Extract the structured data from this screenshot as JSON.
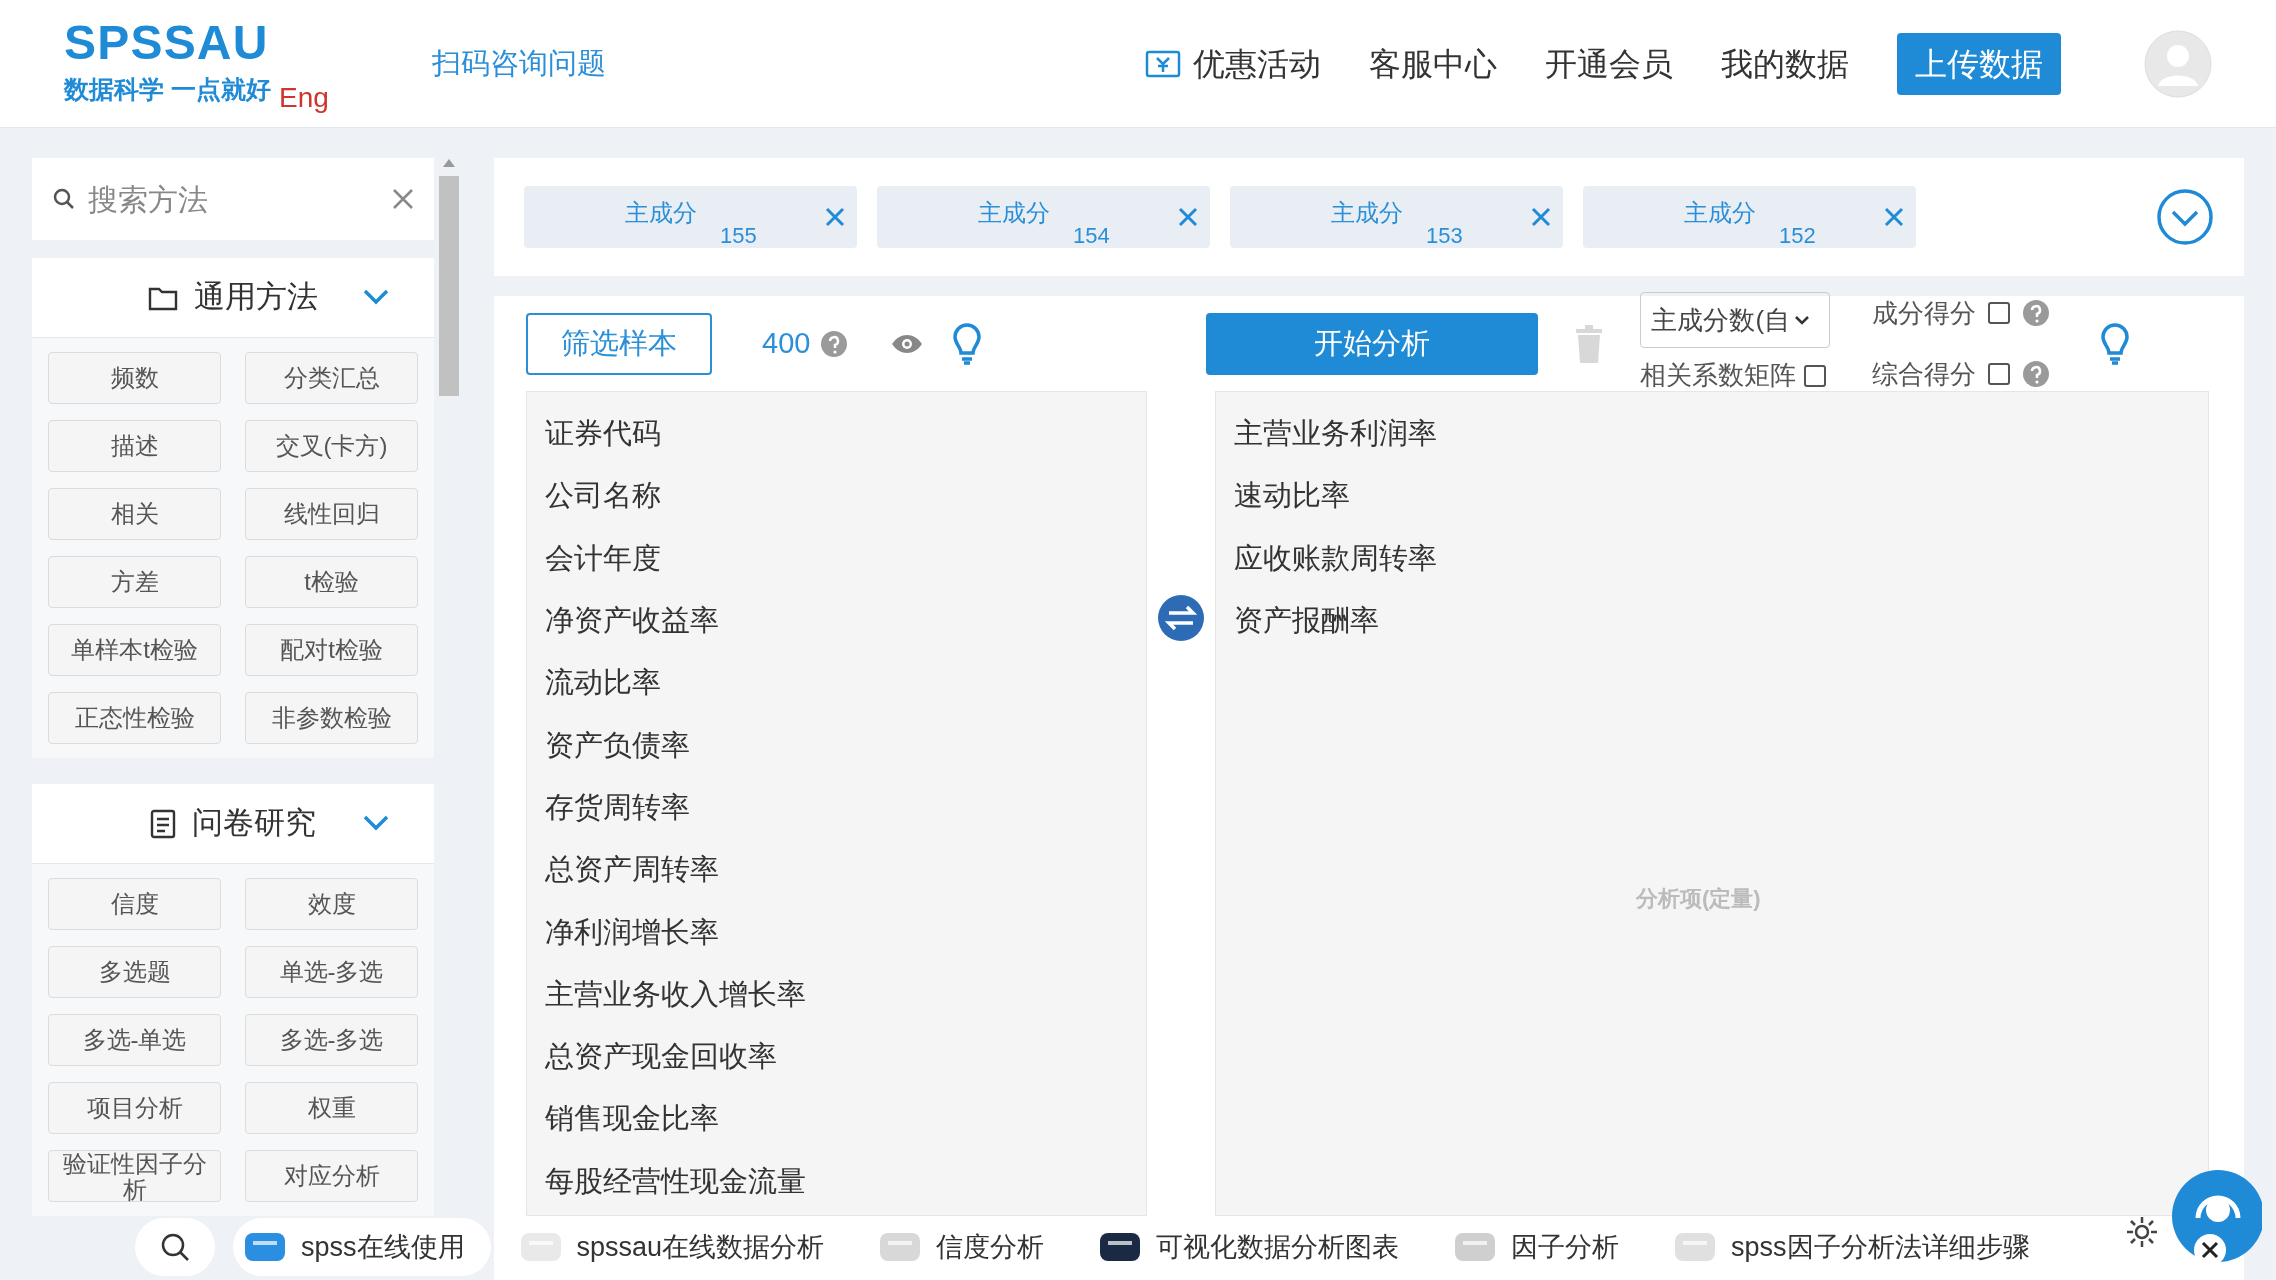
{
  "header": {
    "logo": "SPSSAU",
    "slogan": "数据科学 一点就好",
    "lang": "Eng",
    "scan_link": "扫码咨询问题",
    "nav": [
      {
        "label": "优惠活动",
        "kind": "coupon"
      },
      {
        "label": "客服中心",
        "kind": "plain"
      },
      {
        "label": "开通会员",
        "kind": "plain"
      },
      {
        "label": "我的数据",
        "kind": "plain"
      }
    ],
    "upload": "上传数据"
  },
  "sidebar": {
    "search": {
      "placeholder": "搜索方法"
    },
    "groups": [
      {
        "title": "通用方法",
        "kind": "folder",
        "expanded": true,
        "items": [
          "频数",
          "分类汇总",
          "描述",
          "交叉(卡方)",
          "相关",
          "线性回归",
          "方差",
          "t检验",
          "单样本t检验",
          "配对t检验",
          "正态性检验",
          "非参数检验"
        ]
      },
      {
        "title": "问卷研究",
        "kind": "document",
        "expanded": true,
        "items": [
          "信度",
          "效度",
          "多选题",
          "单选-多选",
          "多选-单选",
          "多选-多选",
          "项目分析",
          "权重",
          "验证性因子分析",
          "对应分析"
        ]
      }
    ]
  },
  "tabs": [
    {
      "label": "主成分",
      "count": "155"
    },
    {
      "label": "主成分",
      "count": "154"
    },
    {
      "label": "主成分",
      "count": "153"
    },
    {
      "label": "主成分",
      "count": "152"
    }
  ],
  "toolbar": {
    "filter": "筛选样本",
    "count": "400",
    "start": "开始分析",
    "select": "主成分数(自",
    "matrix": {
      "label": "相关系数矩阵",
      "checked": false
    },
    "options": [
      {
        "label": "成分得分",
        "checked": false
      },
      {
        "label": "综合得分",
        "checked": false
      }
    ]
  },
  "left_list": [
    "证券代码",
    "公司名称",
    "会计年度",
    "净资产收益率",
    "流动比率",
    "资产负债率",
    "存货周转率",
    "总资产周转率",
    "净利润增长率",
    "主营业务收入增长率",
    "总资产现金回收率",
    "销售现金比率",
    "每股经营性现金流量"
  ],
  "right_list": [
    "主营业务利润率",
    "速动比率",
    "应收账款周转率",
    "资产报酬率"
  ],
  "right_hint": "分析项(定量)",
  "bottom_bar": {
    "items": [
      "spss在线使用",
      "spssau在线数据分析",
      "信度分析",
      "可视化数据分析图表",
      "因子分析",
      "spss因子分析法详细步骤"
    ]
  }
}
